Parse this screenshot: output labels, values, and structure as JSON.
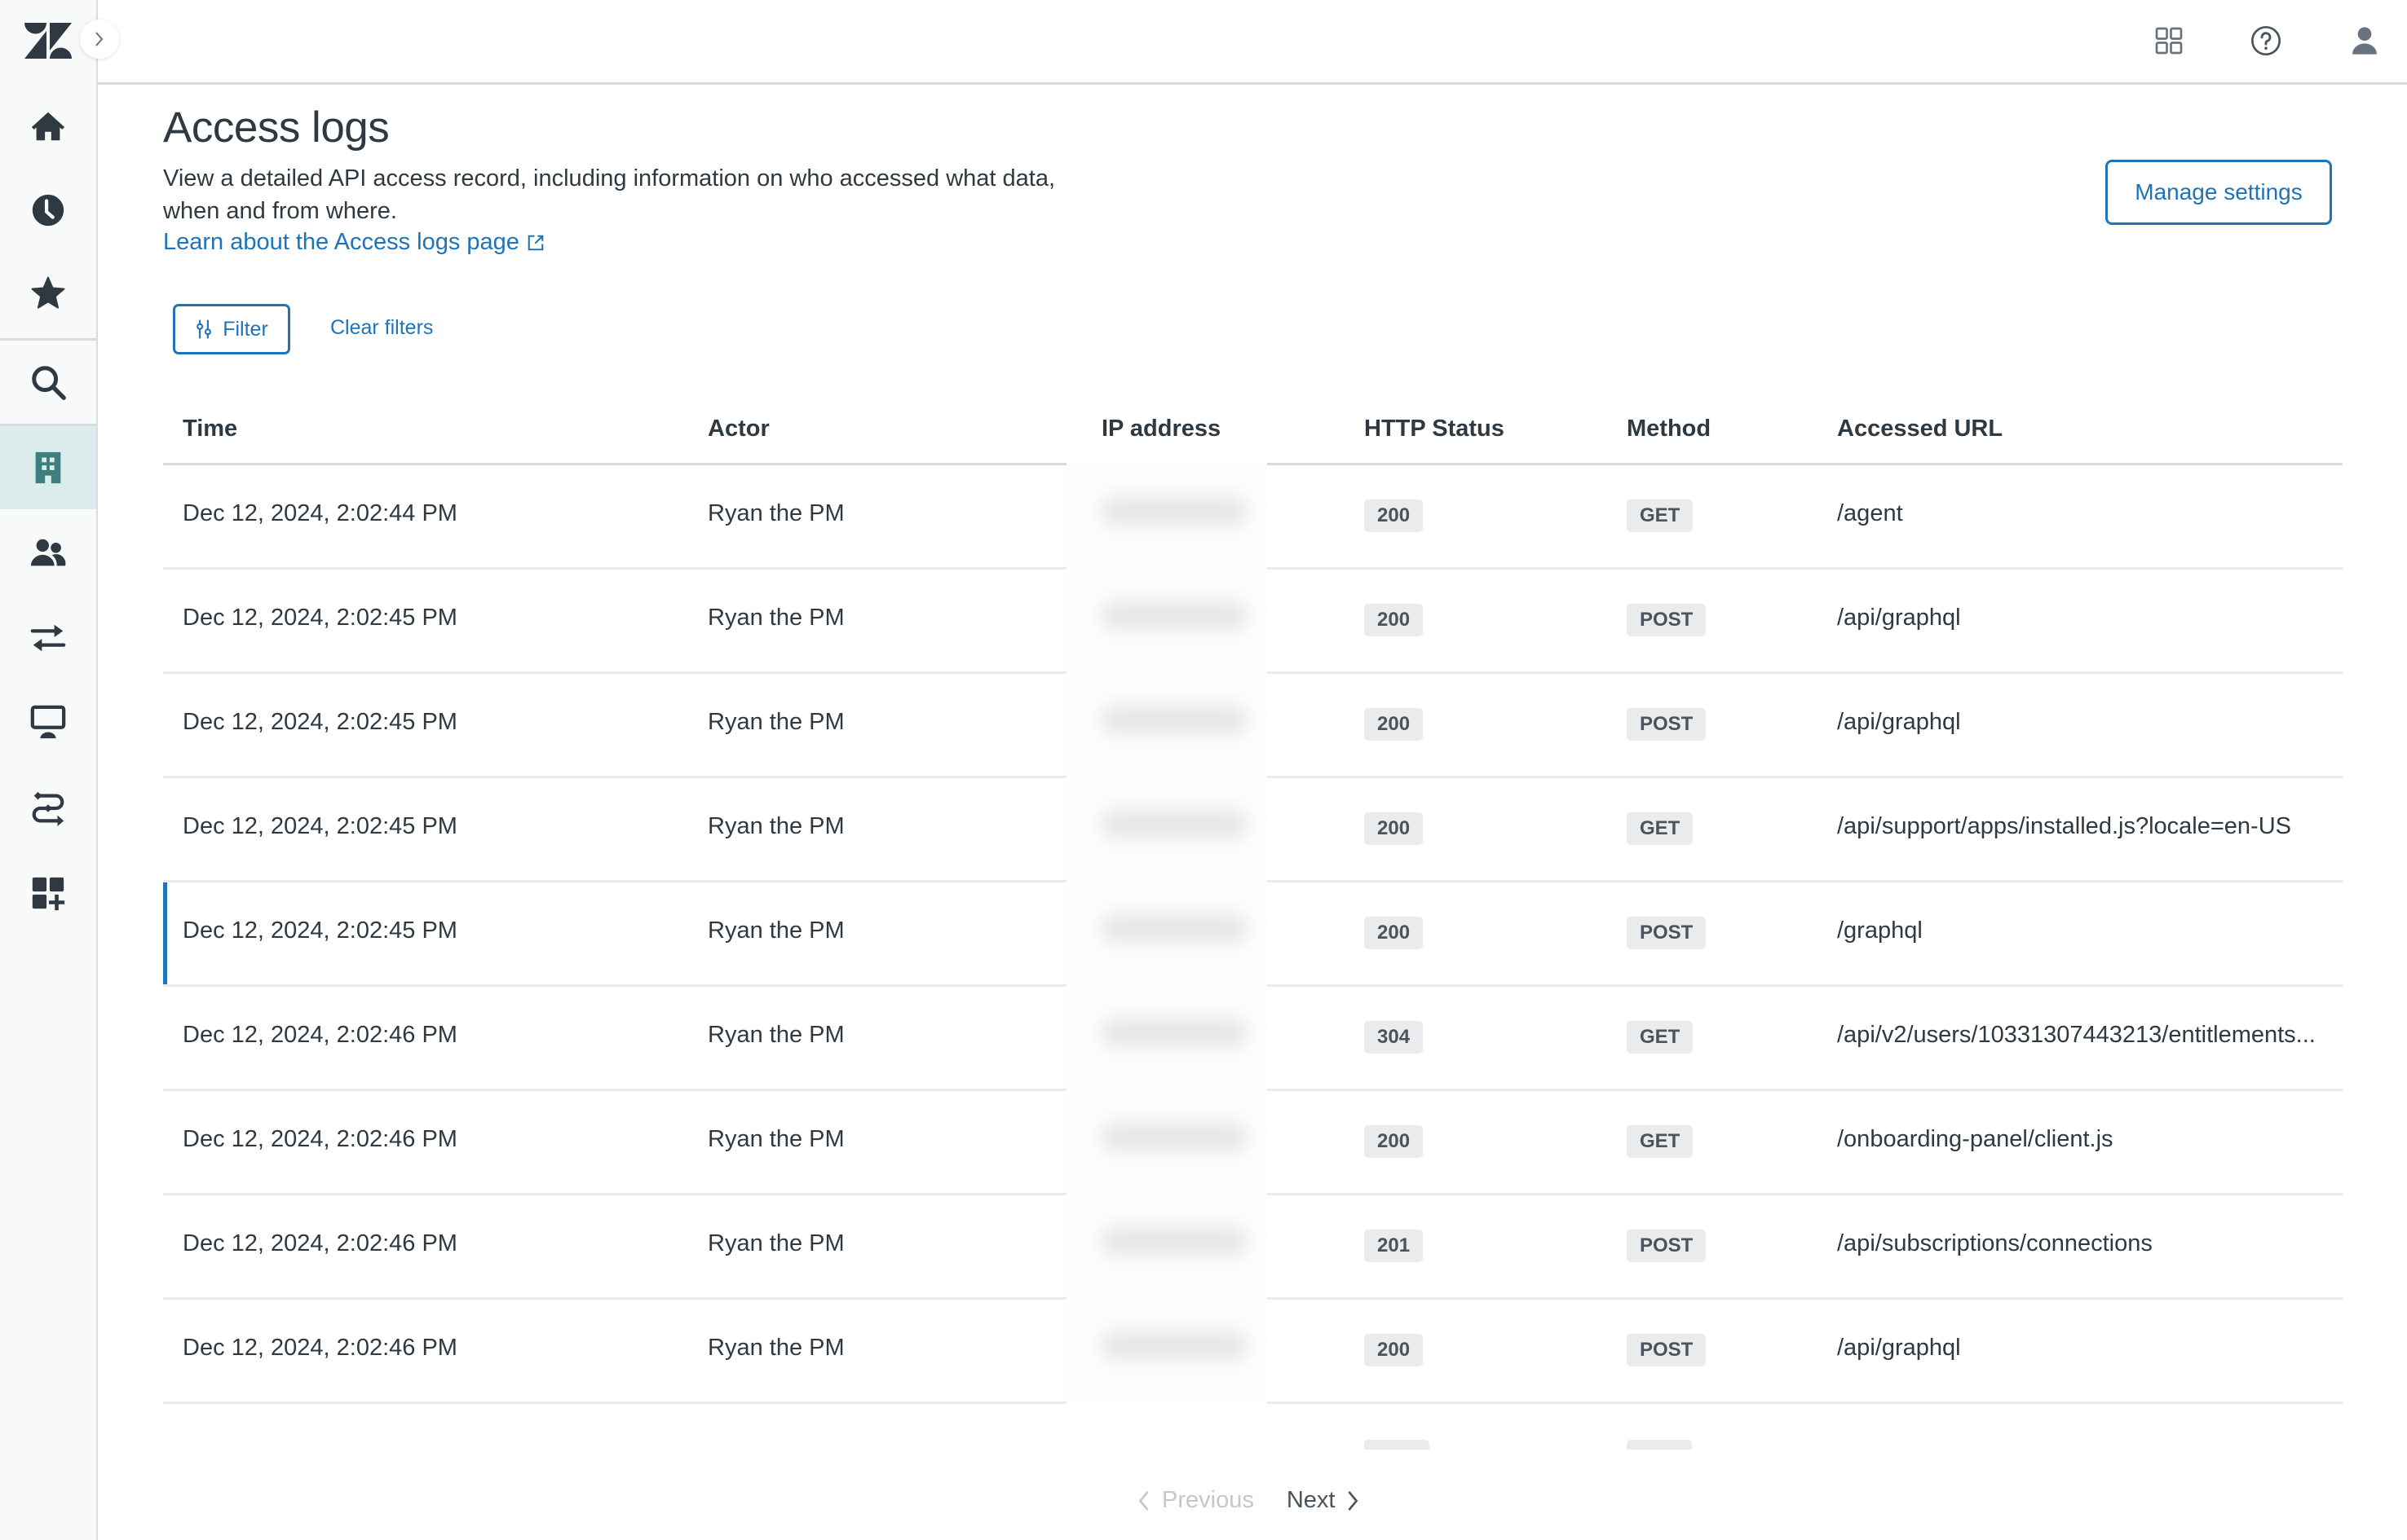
{
  "app": {
    "brand": "Zendesk",
    "accent_color": "#1f73b7",
    "text_color": "#2f3941",
    "selected_nav_bg": "#dcecec",
    "selected_nav_icon_color": "#3d7e7f"
  },
  "sidebar": {
    "expand_icon": "chevron-right-icon",
    "items": [
      {
        "id": "home",
        "icon": "home-icon",
        "selected": false
      },
      {
        "id": "views",
        "icon": "clock-icon",
        "selected": false
      },
      {
        "id": "favorites",
        "icon": "star-icon",
        "selected": false
      },
      {
        "id": "search",
        "icon": "search-icon",
        "selected": false
      },
      {
        "id": "account",
        "icon": "building-icon",
        "selected": true
      },
      {
        "id": "people",
        "icon": "people-icon",
        "selected": false
      },
      {
        "id": "channels",
        "icon": "arrows-exchange-icon",
        "selected": false
      },
      {
        "id": "workspaces",
        "icon": "monitor-icon",
        "selected": false
      },
      {
        "id": "objects-and-rules",
        "icon": "workflow-icon",
        "selected": false
      },
      {
        "id": "apps-integrations",
        "icon": "apps-add-icon",
        "selected": false
      }
    ]
  },
  "topbar": {
    "icons": [
      "product-tray-icon",
      "help-icon",
      "user-icon"
    ]
  },
  "page": {
    "title": "Access logs",
    "description": "View a detailed API access record, including information on who accessed what data, when and from where.",
    "learn_link": "Learn about the Access logs page",
    "manage_settings": "Manage settings",
    "filter": "Filter",
    "clear_filters": "Clear filters"
  },
  "table": {
    "columns": [
      "Time",
      "Actor",
      "IP address",
      "HTTP Status",
      "Method",
      "Accessed URL"
    ],
    "rows": [
      {
        "time": "Dec 12, 2024, 2:02:44 PM",
        "actor": "Ryan the PM",
        "ip_redacted": true,
        "status": "200",
        "method": "GET",
        "url": "/agent",
        "selected": false
      },
      {
        "time": "Dec 12, 2024, 2:02:45 PM",
        "actor": "Ryan the PM",
        "ip_redacted": true,
        "status": "200",
        "method": "POST",
        "url": "/api/graphql",
        "selected": false
      },
      {
        "time": "Dec 12, 2024, 2:02:45 PM",
        "actor": "Ryan the PM",
        "ip_redacted": true,
        "status": "200",
        "method": "POST",
        "url": "/api/graphql",
        "selected": false
      },
      {
        "time": "Dec 12, 2024, 2:02:45 PM",
        "actor": "Ryan the PM",
        "ip_redacted": true,
        "status": "200",
        "method": "GET",
        "url": "/api/support/apps/installed.js?locale=en-US",
        "selected": false
      },
      {
        "time": "Dec 12, 2024, 2:02:45 PM",
        "actor": "Ryan the PM",
        "ip_redacted": true,
        "status": "200",
        "method": "POST",
        "url": "/graphql",
        "selected": true
      },
      {
        "time": "Dec 12, 2024, 2:02:46 PM",
        "actor": "Ryan the PM",
        "ip_redacted": true,
        "status": "304",
        "method": "GET",
        "url": "/api/v2/users/10331307443213/entitlements...",
        "selected": false
      },
      {
        "time": "Dec 12, 2024, 2:02:46 PM",
        "actor": "Ryan the PM",
        "ip_redacted": true,
        "status": "200",
        "method": "GET",
        "url": "/onboarding-panel/client.js",
        "selected": false
      },
      {
        "time": "Dec 12, 2024, 2:02:46 PM",
        "actor": "Ryan the PM",
        "ip_redacted": true,
        "status": "201",
        "method": "POST",
        "url": "/api/subscriptions/connections",
        "selected": false
      },
      {
        "time": "Dec 12, 2024, 2:02:46 PM",
        "actor": "Ryan the PM",
        "ip_redacted": true,
        "status": "200",
        "method": "POST",
        "url": "/api/graphql",
        "selected": false
      }
    ]
  },
  "pagination": {
    "previous": "Previous",
    "next": "Next",
    "previous_enabled": false,
    "next_enabled": true
  }
}
